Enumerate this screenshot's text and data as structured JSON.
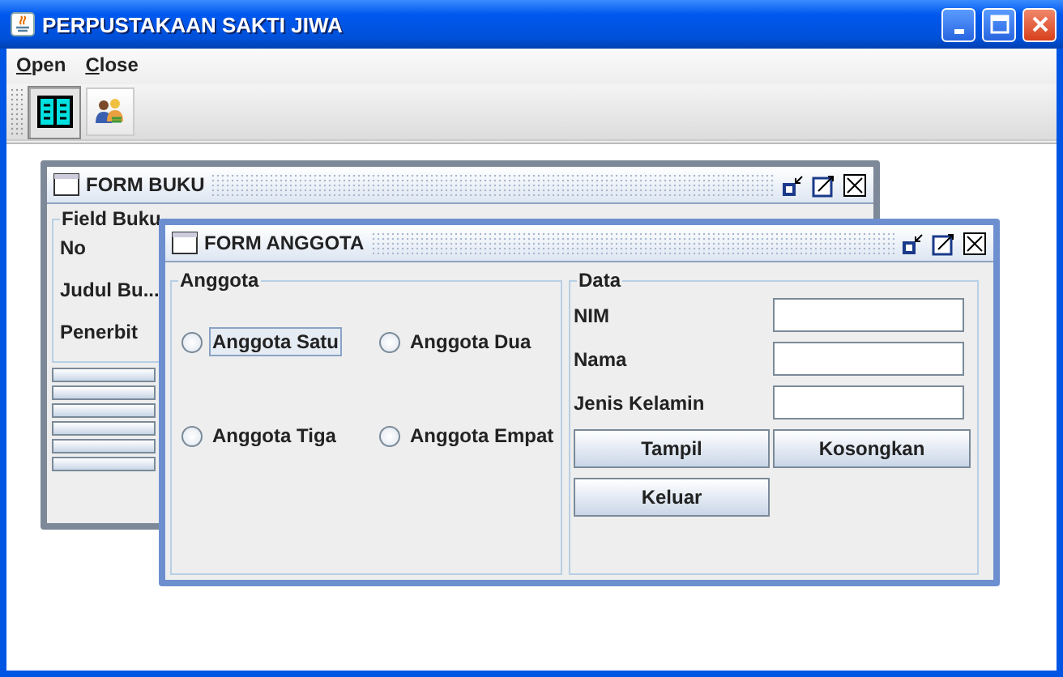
{
  "window": {
    "title": "PERPUSTAKAAN SAKTI JIWA"
  },
  "menu": [
    {
      "label": "Open"
    },
    {
      "label": "Close"
    }
  ],
  "toolbar": [
    {
      "kind": "book",
      "selected": true
    },
    {
      "kind": "people",
      "selected": false
    }
  ],
  "form_buku": {
    "title": "FORM BUKU",
    "field_group": {
      "title": "Field Buku",
      "labels": [
        "No",
        "Judul Bu...",
        "Penerbit"
      ]
    }
  },
  "form_anggota": {
    "title": "FORM ANGGOTA",
    "member_group": {
      "title": "Anggota",
      "options": [
        {
          "label": "Anggota Satu",
          "selected": false,
          "focused": true
        },
        {
          "label": "Anggota Dua",
          "selected": false,
          "focused": false
        },
        {
          "label": "Anggota Tiga",
          "selected": false,
          "focused": false
        },
        {
          "label": "Anggota Empat",
          "selected": false,
          "focused": false
        }
      ]
    },
    "data_group": {
      "title": "Data",
      "fields": [
        {
          "label": "NIM"
        },
        {
          "label": "Nama"
        },
        {
          "label": "Jenis Kelamin"
        }
      ],
      "buttons": [
        "Tampil",
        "Kosongkan",
        "Keluar"
      ]
    }
  }
}
